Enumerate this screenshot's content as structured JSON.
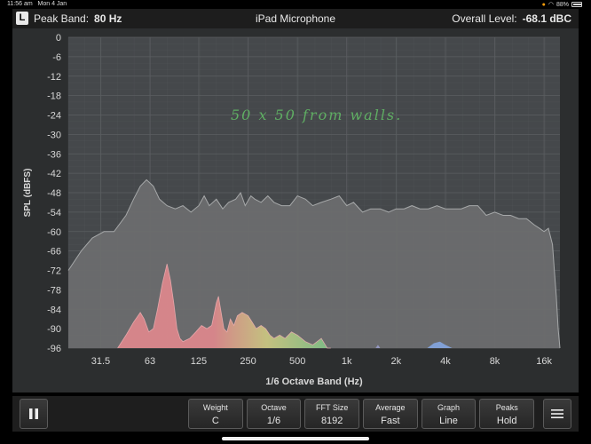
{
  "status_bar": {
    "time": "11:56 am",
    "date": "Mon 4 Jan",
    "battery": "88%",
    "battery_level": 0.88,
    "status_dot_colors": [
      "#ff9f0a",
      "#bbbbbb"
    ]
  },
  "header": {
    "mode_badge": "L",
    "peak_label": "Peak Band:",
    "peak_value": "80 Hz",
    "source_title": "iPad Microphone",
    "overall_label": "Overall Level:",
    "overall_value": "-68.1 dBC"
  },
  "annotation": "50 x 50 from walls.",
  "colors": {
    "panel_bg": "#2c2e2f",
    "plot_bg": "#45484b",
    "grid": "#5b5e61",
    "fill": "#6b6d6e",
    "curve": "#a6a8a9",
    "annotation": "#5fae63"
  },
  "chart_data": {
    "type": "area",
    "xlabel": "1/6 Octave Band (Hz)",
    "ylabel": "SPL (dBFS)",
    "ylim": [
      -96,
      0
    ],
    "yticks": [
      "0",
      "-6",
      "-12",
      "-18",
      "-24",
      "-30",
      "-36",
      "-42",
      "-48",
      "-54",
      "-60",
      "-66",
      "-72",
      "-78",
      "-84",
      "-90",
      "-96"
    ],
    "xlim_hz": [
      20,
      20000
    ],
    "x_scale": "log",
    "xticks": [
      {
        "label": "31.5",
        "hz": 31.5
      },
      {
        "label": "63",
        "hz": 63
      },
      {
        "label": "125",
        "hz": 125
      },
      {
        "label": "250",
        "hz": 250
      },
      {
        "label": "500",
        "hz": 500
      },
      {
        "label": "1k",
        "hz": 1000
      },
      {
        "label": "2k",
        "hz": 2000
      },
      {
        "label": "4k",
        "hz": 4000
      },
      {
        "label": "8k",
        "hz": 8000
      },
      {
        "label": "16k",
        "hz": 16000
      }
    ],
    "peak_hold": [
      [
        20,
        -72
      ],
      [
        24,
        -66
      ],
      [
        28,
        -62
      ],
      [
        33,
        -60
      ],
      [
        38,
        -60
      ],
      [
        45,
        -55
      ],
      [
        50,
        -50
      ],
      [
        55,
        -46
      ],
      [
        60,
        -44
      ],
      [
        66,
        -46
      ],
      [
        72,
        -50
      ],
      [
        80,
        -52
      ],
      [
        90,
        -53
      ],
      [
        100,
        -52
      ],
      [
        112,
        -54
      ],
      [
        125,
        -52
      ],
      [
        135,
        -49
      ],
      [
        145,
        -52
      ],
      [
        160,
        -50
      ],
      [
        175,
        -53
      ],
      [
        190,
        -51
      ],
      [
        210,
        -50
      ],
      [
        225,
        -48
      ],
      [
        240,
        -52
      ],
      [
        260,
        -49
      ],
      [
        275,
        -50
      ],
      [
        300,
        -51
      ],
      [
        330,
        -49
      ],
      [
        360,
        -51
      ],
      [
        400,
        -52
      ],
      [
        450,
        -52
      ],
      [
        500,
        -49
      ],
      [
        560,
        -50
      ],
      [
        620,
        -52
      ],
      [
        700,
        -51
      ],
      [
        800,
        -50
      ],
      [
        900,
        -49
      ],
      [
        1000,
        -52
      ],
      [
        1100,
        -51
      ],
      [
        1250,
        -54
      ],
      [
        1400,
        -53
      ],
      [
        1600,
        -53
      ],
      [
        1800,
        -54
      ],
      [
        2000,
        -53
      ],
      [
        2240,
        -53
      ],
      [
        2500,
        -52
      ],
      [
        2800,
        -53
      ],
      [
        3150,
        -53
      ],
      [
        3550,
        -52
      ],
      [
        4000,
        -53
      ],
      [
        4500,
        -53
      ],
      [
        5000,
        -53
      ],
      [
        5600,
        -52
      ],
      [
        6300,
        -52
      ],
      [
        7100,
        -55
      ],
      [
        8000,
        -54
      ],
      [
        9000,
        -55
      ],
      [
        10000,
        -55
      ],
      [
        11200,
        -56
      ],
      [
        12500,
        -56
      ],
      [
        14000,
        -58
      ],
      [
        15000,
        -59
      ],
      [
        16000,
        -60
      ],
      [
        17000,
        -59
      ],
      [
        18000,
        -64
      ],
      [
        18500,
        -72
      ],
      [
        19000,
        -80
      ],
      [
        19500,
        -90
      ],
      [
        20000,
        -96
      ]
    ],
    "live_band_colors": {
      "low": "#e88a8f",
      "mid": "#d4d083",
      "high": "#7fc98a",
      "top": "#86a9e8"
    },
    "live": [
      [
        40,
        -96
      ],
      [
        45,
        -92
      ],
      [
        50,
        -88
      ],
      [
        55,
        -85
      ],
      [
        58,
        -87
      ],
      [
        62,
        -91
      ],
      [
        66,
        -90
      ],
      [
        70,
        -84
      ],
      [
        75,
        -76
      ],
      [
        80,
        -70
      ],
      [
        84,
        -75
      ],
      [
        88,
        -82
      ],
      [
        92,
        -90
      ],
      [
        96,
        -93
      ],
      [
        100,
        -94
      ],
      [
        110,
        -93
      ],
      [
        120,
        -91
      ],
      [
        130,
        -89
      ],
      [
        140,
        -90
      ],
      [
        150,
        -89
      ],
      [
        160,
        -82
      ],
      [
        165,
        -80
      ],
      [
        170,
        -84
      ],
      [
        178,
        -90
      ],
      [
        186,
        -91
      ],
      [
        195,
        -87
      ],
      [
        205,
        -89
      ],
      [
        215,
        -86
      ],
      [
        230,
        -85
      ],
      [
        250,
        -86
      ],
      [
        265,
        -88
      ],
      [
        280,
        -90
      ],
      [
        300,
        -89
      ],
      [
        320,
        -90
      ],
      [
        340,
        -92
      ],
      [
        360,
        -93
      ],
      [
        390,
        -92
      ],
      [
        420,
        -93
      ],
      [
        460,
        -91
      ],
      [
        500,
        -92
      ],
      [
        560,
        -94
      ],
      [
        620,
        -95
      ],
      [
        700,
        -93
      ],
      [
        760,
        -96
      ],
      [
        800,
        -96
      ]
    ],
    "live_blip": [
      [
        1500,
        -96
      ],
      [
        1550,
        -95
      ],
      [
        1600,
        -96
      ]
    ],
    "live_hf": [
      [
        3100,
        -96
      ],
      [
        3400,
        -94.5
      ],
      [
        3700,
        -94
      ],
      [
        4000,
        -95
      ],
      [
        4400,
        -96
      ]
    ]
  },
  "controls": {
    "settings": [
      {
        "label": "Weight",
        "value": "C"
      },
      {
        "label": "Octave",
        "value": "1/6"
      },
      {
        "label": "FFT Size",
        "value": "8192"
      },
      {
        "label": "Average",
        "value": "Fast"
      },
      {
        "label": "Graph",
        "value": "Line"
      },
      {
        "label": "Peaks",
        "value": "Hold"
      }
    ],
    "pause_icon": "pause-icon",
    "menu_icon": "hamburger-menu-icon"
  }
}
